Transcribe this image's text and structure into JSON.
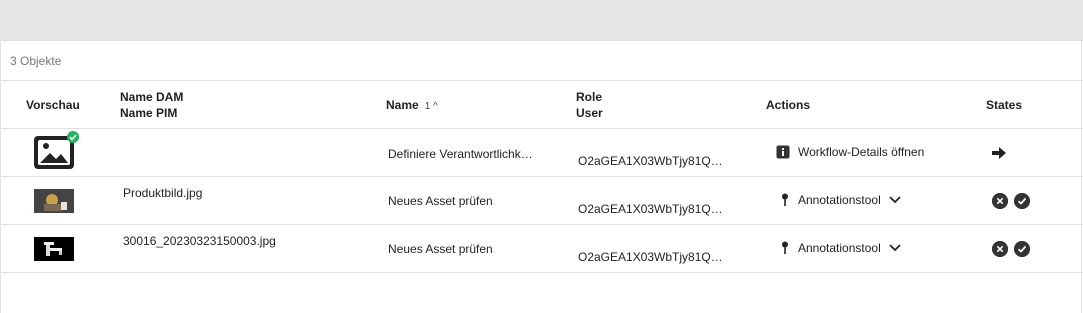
{
  "list": {
    "count_label": "3 Objekte"
  },
  "columns": {
    "preview": "Vorschau",
    "name_dam": "Name DAM",
    "name_pim": "Name PIM",
    "name": "Name",
    "name_sort": "1 ^",
    "role": "Role",
    "user": "User",
    "actions": "Actions",
    "states": "States"
  },
  "rows": [
    {
      "name_dam": "",
      "task_name": "Definiere Verantwortlichk…",
      "user": "O2aGEA1X03WbTjy81Q…",
      "action_label": "Workflow-Details öffnen",
      "action_icon": "info-icon",
      "state_icons": [
        "arrow-right-icon"
      ]
    },
    {
      "name_dam": "Produktbild.jpg",
      "task_name": "Neues Asset prüfen",
      "user": "O2aGEA1X03WbTjy81Q…",
      "action_label": "Annotationstool",
      "action_icon": "pin-icon",
      "state_icons": [
        "reject-icon",
        "approve-icon"
      ]
    },
    {
      "name_dam": "30016_20230323150003.jpg",
      "task_name": "Neues Asset prüfen",
      "user": "O2aGEA1X03WbTjy81Q…",
      "action_label": "Annotationstool",
      "action_icon": "pin-icon",
      "state_icons": [
        "reject-icon",
        "approve-icon"
      ]
    }
  ],
  "colors": {
    "topbar": "#e7e7e7",
    "badge_green": "#22b35e",
    "icon_dark": "#333333"
  }
}
